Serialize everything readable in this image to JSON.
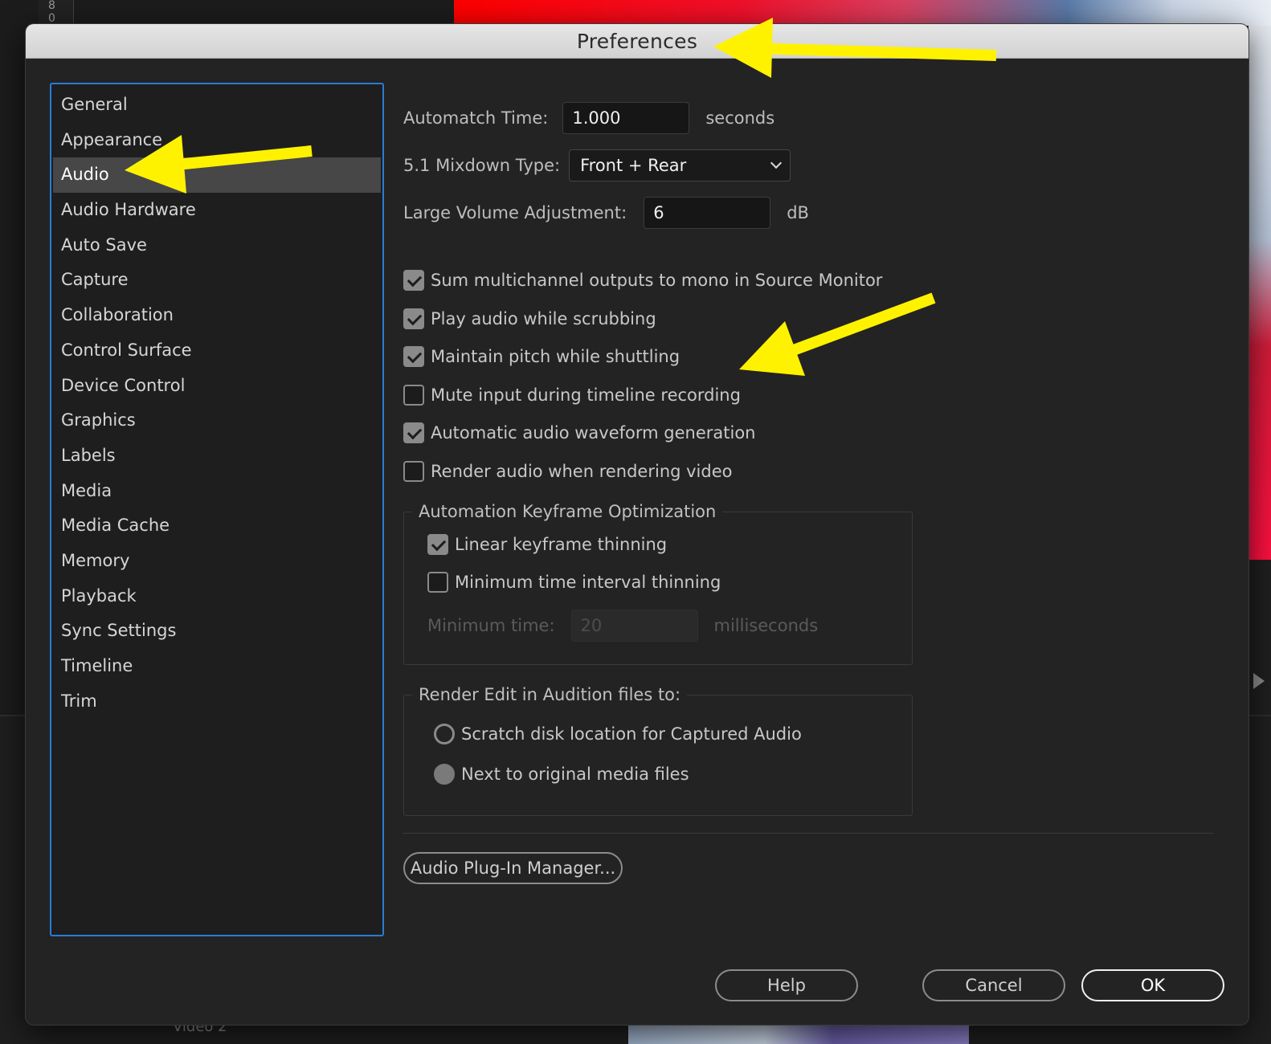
{
  "background": {
    "ruler_digits": [
      "8",
      "0"
    ],
    "timeline_track_label": "Video 2"
  },
  "dialog": {
    "title": "Preferences",
    "categories": [
      {
        "label": "General"
      },
      {
        "label": "Appearance"
      },
      {
        "label": "Audio"
      },
      {
        "label": "Audio Hardware"
      },
      {
        "label": "Auto Save"
      },
      {
        "label": "Capture"
      },
      {
        "label": "Collaboration"
      },
      {
        "label": "Control Surface"
      },
      {
        "label": "Device Control"
      },
      {
        "label": "Graphics"
      },
      {
        "label": "Labels"
      },
      {
        "label": "Media"
      },
      {
        "label": "Media Cache"
      },
      {
        "label": "Memory"
      },
      {
        "label": "Playback"
      },
      {
        "label": "Sync Settings"
      },
      {
        "label": "Timeline"
      },
      {
        "label": "Trim"
      }
    ],
    "selected_category": "Audio",
    "audio": {
      "automatch": {
        "label": "Automatch Time:",
        "value": "1.000",
        "unit": "seconds"
      },
      "mixdown": {
        "label": "5.1 Mixdown Type:",
        "value": "Front + Rear"
      },
      "large_volume": {
        "label": "Large Volume Adjustment:",
        "value": "6",
        "unit": "dB"
      },
      "checkboxes": [
        {
          "label": "Sum multichannel outputs to mono in Source Monitor",
          "checked": true
        },
        {
          "label": "Play audio while scrubbing",
          "checked": true
        },
        {
          "label": "Maintain pitch while shuttling",
          "checked": true
        },
        {
          "label": "Mute input during timeline recording",
          "checked": false
        },
        {
          "label": "Automatic audio waveform generation",
          "checked": true
        },
        {
          "label": "Render audio when rendering video",
          "checked": false
        }
      ],
      "keyframe_group": {
        "title": "Automation Keyframe Optimization",
        "linear": {
          "label": "Linear keyframe thinning",
          "checked": true
        },
        "min_interval": {
          "label": "Minimum time interval thinning",
          "checked": false
        },
        "min_time": {
          "label": "Minimum time:",
          "value": "20",
          "unit": "milliseconds"
        }
      },
      "render_group": {
        "title": "Render Edit in Audition files to:",
        "options": [
          {
            "label": "Scratch disk location for Captured Audio",
            "selected": false
          },
          {
            "label": "Next to original media files",
            "selected": true
          }
        ]
      },
      "plugin_manager_label": "Audio Plug-In Manager..."
    },
    "footer": {
      "help_label": "Help",
      "cancel_label": "Cancel",
      "ok_label": "OK"
    }
  },
  "colors": {
    "selection_border": "#2a7bd6",
    "annotation_arrow": "#fff200",
    "dialog_bg": "#232323"
  }
}
